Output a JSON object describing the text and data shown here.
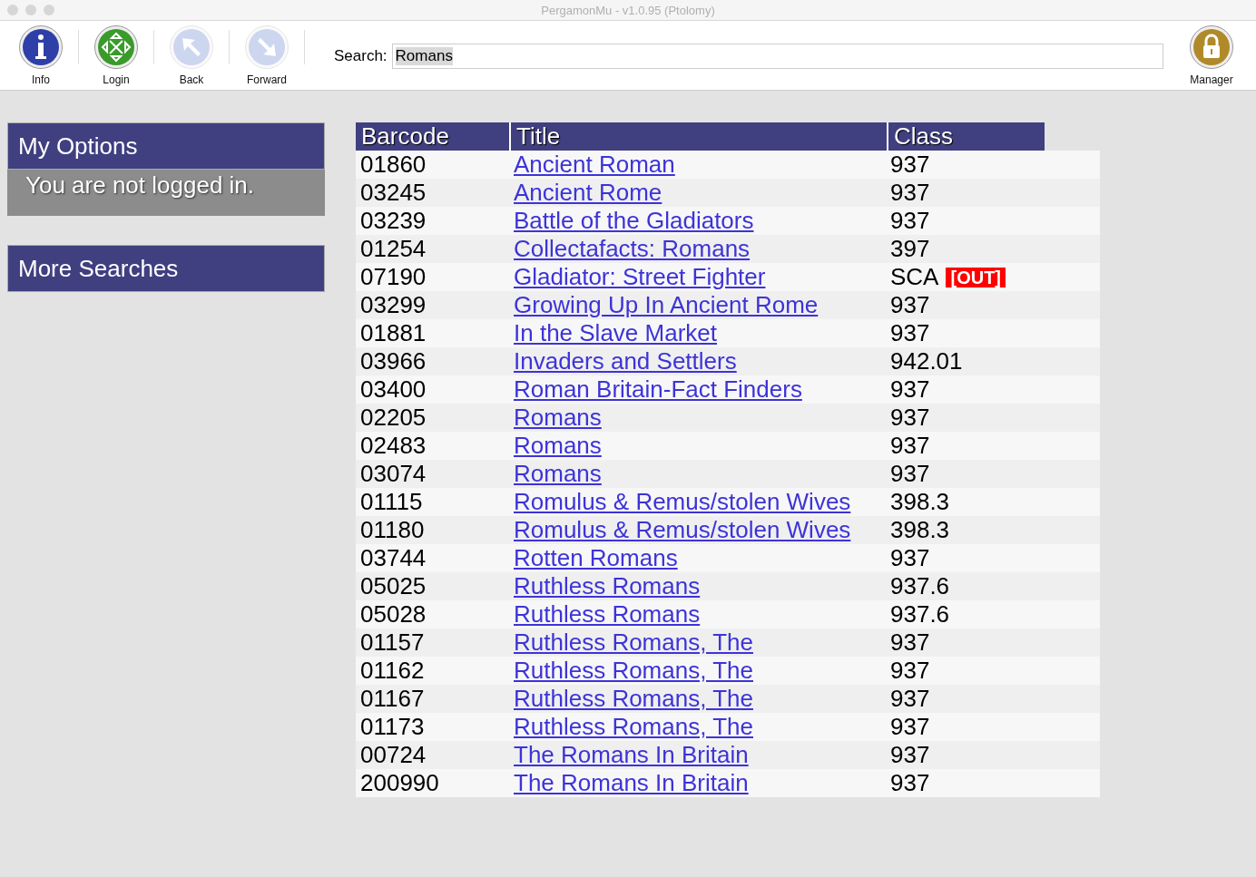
{
  "window": {
    "title": "PergamonMu - v1.0.95 (Ptolomy)"
  },
  "toolbar": {
    "buttons": [
      {
        "kind": "info",
        "label": "Info",
        "disabled": false
      },
      {
        "kind": "login",
        "label": "Login",
        "disabled": false
      },
      {
        "kind": "back",
        "label": "Back",
        "disabled": true
      },
      {
        "kind": "forward",
        "label": "Forward",
        "disabled": true
      }
    ],
    "search_label": "Search:",
    "search_value": "Romans",
    "manager": {
      "kind": "lock",
      "label": "Manager",
      "disabled": false
    }
  },
  "sidebar": {
    "panels": [
      {
        "title": "My Options",
        "message": "You are not logged in."
      },
      {
        "title": "More Searches"
      }
    ]
  },
  "table": {
    "columns": [
      "Barcode",
      "Title",
      "Class"
    ],
    "rows": [
      {
        "barcode": "01860",
        "title": "Ancient Roman",
        "class": "937"
      },
      {
        "barcode": "03245",
        "title": "Ancient Rome",
        "class": "937"
      },
      {
        "barcode": "03239",
        "title": "Battle of the Gladiators",
        "class": "937"
      },
      {
        "barcode": "01254",
        "title": "Collectafacts: Romans",
        "class": "397"
      },
      {
        "barcode": "07190",
        "title": "Gladiator: Street Fighter",
        "class": "SCA",
        "badge": "[OUT]"
      },
      {
        "barcode": "03299",
        "title": "Growing Up In Ancient Rome",
        "class": "937"
      },
      {
        "barcode": "01881",
        "title": "In the Slave Market",
        "class": "937"
      },
      {
        "barcode": "03966",
        "title": "Invaders and Settlers",
        "class": "942.01"
      },
      {
        "barcode": "03400",
        "title": "Roman Britain-Fact Finders",
        "class": "937"
      },
      {
        "barcode": "02205",
        "title": "Romans",
        "class": "937"
      },
      {
        "barcode": "02483",
        "title": "Romans",
        "class": "937"
      },
      {
        "barcode": "03074",
        "title": "Romans",
        "class": "937"
      },
      {
        "barcode": "01115",
        "title": "Romulus & Remus/stolen Wives",
        "class": "398.3"
      },
      {
        "barcode": "01180",
        "title": "Romulus & Remus/stolen Wives",
        "class": "398.3"
      },
      {
        "barcode": "03744",
        "title": "Rotten Romans",
        "class": "937"
      },
      {
        "barcode": "05025",
        "title": "Ruthless Romans",
        "class": "937.6"
      },
      {
        "barcode": "05028",
        "title": "Ruthless Romans",
        "class": "937.6"
      },
      {
        "barcode": "01157",
        "title": "Ruthless Romans, The",
        "class": "937"
      },
      {
        "barcode": "01162",
        "title": "Ruthless Romans, The",
        "class": "937"
      },
      {
        "barcode": "01167",
        "title": "Ruthless Romans, The",
        "class": "937"
      },
      {
        "barcode": "01173",
        "title": "Ruthless Romans, The",
        "class": "937"
      },
      {
        "barcode": "00724",
        "title": "The Romans In Britain",
        "class": "937"
      },
      {
        "barcode": "200990",
        "title": "The Romans In Britain",
        "class": "937"
      }
    ]
  }
}
